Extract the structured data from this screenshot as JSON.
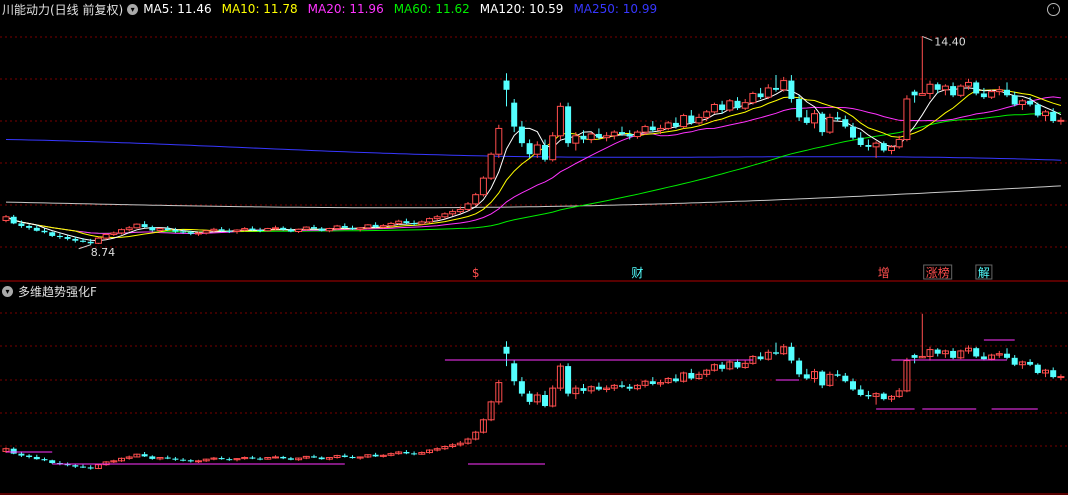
{
  "colors": {
    "up": "#ff4e4e",
    "down": "#54ffff",
    "ma5": "#ffffff",
    "ma10": "#ffff00",
    "ma20": "#ff33ff",
    "ma60": "#00ee00",
    "ma120": "#c8c8c8",
    "ma250": "#3737ff",
    "grid": "#7a0000",
    "axis": "#b00000"
  },
  "header": {
    "title": "川能动力(日线 前复权)",
    "legend": [
      {
        "label": "MA5: 11.46",
        "color": "#ffffff"
      },
      {
        "label": "MA10: 11.78",
        "color": "#ffff00"
      },
      {
        "label": "MA20: 11.96",
        "color": "#ff33ff"
      },
      {
        "label": "MA60: 11.62",
        "color": "#00ee00"
      },
      {
        "label": "MA120: 10.59",
        "color": "#ffffff"
      },
      {
        "label": "MA250: 10.99",
        "color": "#3737ff"
      }
    ]
  },
  "indicator": {
    "title": "多维趋势强化F"
  },
  "chart_data": {
    "type": "candlestick",
    "price_high_label": "14.40",
    "price_low_label": "8.74",
    "event_markers": [
      {
        "label": "$",
        "index": 61,
        "color": "#ff4e4e"
      },
      {
        "label": "财",
        "index": 82,
        "color": "#54ffff"
      },
      {
        "label": "增",
        "index": 114,
        "color": "#ff4e4e"
      },
      {
        "label": "涨榜",
        "index": 121,
        "color": "#ff4e4e",
        "boxed": true
      },
      {
        "label": "解",
        "index": 127,
        "color": "#54ffff",
        "boxed": true
      }
    ],
    "candles": [
      [
        9.4,
        9.55,
        9.35,
        9.5
      ],
      [
        9.5,
        9.55,
        9.3,
        9.32
      ],
      [
        9.32,
        9.4,
        9.2,
        9.25
      ],
      [
        9.25,
        9.3,
        9.15,
        9.2
      ],
      [
        9.2,
        9.28,
        9.1,
        9.12
      ],
      [
        9.12,
        9.18,
        9.05,
        9.08
      ],
      [
        9.08,
        9.1,
        8.95,
        8.98
      ],
      [
        8.98,
        9.05,
        8.9,
        8.95
      ],
      [
        8.95,
        9.0,
        8.86,
        8.9
      ],
      [
        8.9,
        8.96,
        8.8,
        8.85
      ],
      [
        8.85,
        8.92,
        8.8,
        8.82
      ],
      [
        8.82,
        8.9,
        8.74,
        8.78
      ],
      [
        8.78,
        8.95,
        8.76,
        8.92
      ],
      [
        8.92,
        9.05,
        8.88,
        9.02
      ],
      [
        9.02,
        9.1,
        8.98,
        9.06
      ],
      [
        9.06,
        9.18,
        9.02,
        9.15
      ],
      [
        9.15,
        9.25,
        9.1,
        9.2
      ],
      [
        9.2,
        9.32,
        9.18,
        9.3
      ],
      [
        9.3,
        9.38,
        9.2,
        9.22
      ],
      [
        9.22,
        9.26,
        9.1,
        9.13
      ],
      [
        9.13,
        9.2,
        9.08,
        9.18
      ],
      [
        9.18,
        9.25,
        9.12,
        9.14
      ],
      [
        9.14,
        9.2,
        9.06,
        9.1
      ],
      [
        9.1,
        9.16,
        9.04,
        9.08
      ],
      [
        9.08,
        9.12,
        9.0,
        9.04
      ],
      [
        9.04,
        9.1,
        8.98,
        9.06
      ],
      [
        9.06,
        9.14,
        9.02,
        9.12
      ],
      [
        9.12,
        9.2,
        9.08,
        9.16
      ],
      [
        9.16,
        9.22,
        9.1,
        9.12
      ],
      [
        9.12,
        9.18,
        9.06,
        9.1
      ],
      [
        9.1,
        9.16,
        9.04,
        9.14
      ],
      [
        9.14,
        9.22,
        9.1,
        9.18
      ],
      [
        9.18,
        9.24,
        9.12,
        9.14
      ],
      [
        9.14,
        9.2,
        9.08,
        9.12
      ],
      [
        9.12,
        9.2,
        9.1,
        9.18
      ],
      [
        9.18,
        9.26,
        9.14,
        9.2
      ],
      [
        9.2,
        9.24,
        9.12,
        9.15
      ],
      [
        9.15,
        9.2,
        9.08,
        9.1
      ],
      [
        9.1,
        9.18,
        9.06,
        9.16
      ],
      [
        9.16,
        9.24,
        9.12,
        9.22
      ],
      [
        9.22,
        9.28,
        9.16,
        9.18
      ],
      [
        9.18,
        9.22,
        9.1,
        9.12
      ],
      [
        9.12,
        9.2,
        9.08,
        9.18
      ],
      [
        9.18,
        9.28,
        9.14,
        9.25
      ],
      [
        9.25,
        9.32,
        9.18,
        9.2
      ],
      [
        9.2,
        9.26,
        9.14,
        9.16
      ],
      [
        9.16,
        9.22,
        9.1,
        9.2
      ],
      [
        9.2,
        9.3,
        9.16,
        9.28
      ],
      [
        9.28,
        9.35,
        9.2,
        9.22
      ],
      [
        9.22,
        9.3,
        9.18,
        9.26
      ],
      [
        9.26,
        9.36,
        9.22,
        9.32
      ],
      [
        9.32,
        9.42,
        9.28,
        9.38
      ],
      [
        9.38,
        9.45,
        9.3,
        9.33
      ],
      [
        9.33,
        9.4,
        9.26,
        9.3
      ],
      [
        9.3,
        9.4,
        9.28,
        9.36
      ],
      [
        9.36,
        9.48,
        9.32,
        9.45
      ],
      [
        9.45,
        9.55,
        9.4,
        9.5
      ],
      [
        9.5,
        9.62,
        9.45,
        9.58
      ],
      [
        9.58,
        9.7,
        9.52,
        9.64
      ],
      [
        9.64,
        9.78,
        9.58,
        9.7
      ],
      [
        9.7,
        9.9,
        9.65,
        9.85
      ],
      [
        9.85,
        10.15,
        9.8,
        10.1
      ],
      [
        10.1,
        10.6,
        10.05,
        10.55
      ],
      [
        10.55,
        11.25,
        10.5,
        11.2
      ],
      [
        11.2,
        12.0,
        11.1,
        11.9
      ],
      [
        13.2,
        13.4,
        12.5,
        12.95
      ],
      [
        12.6,
        12.7,
        11.8,
        11.95
      ],
      [
        11.95,
        12.1,
        11.4,
        11.5
      ],
      [
        11.5,
        11.6,
        11.1,
        11.2
      ],
      [
        11.2,
        11.55,
        11.1,
        11.45
      ],
      [
        11.45,
        11.6,
        11.0,
        11.05
      ],
      [
        11.05,
        11.8,
        11.0,
        11.7
      ],
      [
        11.7,
        12.6,
        11.6,
        12.5
      ],
      [
        12.5,
        12.6,
        11.4,
        11.5
      ],
      [
        11.5,
        11.8,
        11.3,
        11.7
      ],
      [
        11.7,
        11.85,
        11.5,
        11.6
      ],
      [
        11.6,
        11.8,
        11.5,
        11.75
      ],
      [
        11.75,
        11.9,
        11.6,
        11.65
      ],
      [
        11.65,
        11.8,
        11.55,
        11.7
      ],
      [
        11.7,
        11.85,
        11.6,
        11.8
      ],
      [
        11.8,
        11.95,
        11.7,
        11.75
      ],
      [
        11.75,
        11.85,
        11.6,
        11.68
      ],
      [
        11.68,
        11.85,
        11.62,
        11.8
      ],
      [
        11.8,
        12.0,
        11.72,
        11.95
      ],
      [
        11.95,
        12.1,
        11.8,
        11.85
      ],
      [
        11.85,
        12.0,
        11.75,
        11.9
      ],
      [
        11.9,
        12.1,
        11.85,
        12.05
      ],
      [
        12.05,
        12.2,
        11.9,
        11.95
      ],
      [
        11.95,
        12.3,
        11.9,
        12.25
      ],
      [
        12.25,
        12.4,
        12.0,
        12.05
      ],
      [
        12.05,
        12.3,
        12.0,
        12.2
      ],
      [
        12.2,
        12.4,
        12.1,
        12.35
      ],
      [
        12.35,
        12.6,
        12.3,
        12.55
      ],
      [
        12.55,
        12.65,
        12.3,
        12.4
      ],
      [
        12.4,
        12.7,
        12.35,
        12.65
      ],
      [
        12.65,
        12.75,
        12.4,
        12.45
      ],
      [
        12.45,
        12.7,
        12.4,
        12.6
      ],
      [
        12.6,
        12.9,
        12.55,
        12.85
      ],
      [
        12.85,
        13.0,
        12.7,
        12.75
      ],
      [
        12.75,
        13.1,
        12.7,
        13.0
      ],
      [
        13.0,
        13.35,
        12.9,
        12.95
      ],
      [
        12.95,
        13.3,
        12.9,
        13.2
      ],
      [
        13.2,
        13.35,
        12.6,
        12.7
      ],
      [
        12.7,
        12.8,
        12.1,
        12.2
      ],
      [
        12.2,
        12.4,
        12.0,
        12.05
      ],
      [
        12.05,
        12.4,
        11.9,
        12.3
      ],
      [
        12.3,
        12.35,
        11.7,
        11.8
      ],
      [
        11.8,
        12.3,
        11.75,
        12.2
      ],
      [
        12.2,
        12.35,
        12.1,
        12.15
      ],
      [
        12.15,
        12.25,
        11.9,
        11.95
      ],
      [
        11.95,
        12.05,
        11.6,
        11.65
      ],
      [
        11.65,
        11.8,
        11.4,
        11.45
      ],
      [
        11.45,
        11.6,
        11.3,
        11.4
      ],
      [
        11.4,
        11.55,
        11.1,
        11.5
      ],
      [
        11.5,
        11.55,
        11.25,
        11.3
      ],
      [
        11.3,
        11.45,
        11.2,
        11.4
      ],
      [
        11.4,
        11.7,
        11.35,
        11.6
      ],
      [
        11.6,
        12.8,
        11.55,
        12.7
      ],
      [
        12.9,
        12.95,
        12.6,
        12.8
      ],
      [
        12.8,
        14.4,
        12.8,
        12.85
      ],
      [
        12.85,
        13.2,
        12.7,
        13.1
      ],
      [
        13.1,
        13.15,
        12.85,
        12.95
      ],
      [
        12.95,
        13.1,
        12.8,
        13.05
      ],
      [
        13.05,
        13.15,
        12.75,
        12.8
      ],
      [
        12.8,
        13.1,
        12.75,
        13.05
      ],
      [
        13.05,
        13.25,
        12.95,
        13.15
      ],
      [
        13.15,
        13.2,
        12.8,
        12.85
      ],
      [
        12.85,
        13.0,
        12.7,
        12.75
      ],
      [
        12.75,
        12.95,
        12.7,
        12.9
      ],
      [
        12.9,
        13.05,
        12.8,
        12.95
      ],
      [
        12.95,
        13.15,
        12.75,
        12.8
      ],
      [
        12.8,
        12.9,
        12.5,
        12.55
      ],
      [
        12.55,
        12.7,
        12.4,
        12.65
      ],
      [
        12.65,
        12.75,
        12.5,
        12.55
      ],
      [
        12.55,
        12.6,
        12.2,
        12.25
      ],
      [
        12.25,
        12.4,
        12.1,
        12.35
      ],
      [
        12.35,
        12.45,
        12.05,
        12.1
      ],
      [
        12.1,
        12.2,
        12.0,
        12.12
      ]
    ]
  }
}
